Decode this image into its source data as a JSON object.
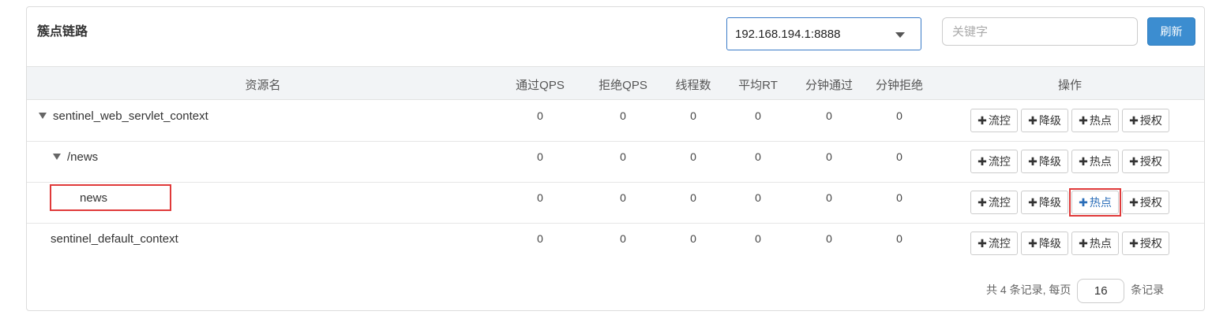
{
  "panel": {
    "title": "簇点链路"
  },
  "toolbar": {
    "machine_select_value": "192.168.194.1:8888",
    "search_placeholder": "关键字",
    "refresh_label": "刷新"
  },
  "table": {
    "columns": [
      "资源名",
      "通过QPS",
      "拒绝QPS",
      "线程数",
      "平均RT",
      "分钟通过",
      "分钟拒绝",
      "操作"
    ],
    "rows": [
      {
        "name": "sentinel_web_servlet_context",
        "pass_qps": "0",
        "block_qps": "0",
        "threads": "0",
        "avg_rt": "0",
        "minute_pass": "0",
        "minute_block": "0"
      },
      {
        "name": "/news",
        "pass_qps": "0",
        "block_qps": "0",
        "threads": "0",
        "avg_rt": "0",
        "minute_pass": "0",
        "minute_block": "0"
      },
      {
        "name": "news",
        "pass_qps": "0",
        "block_qps": "0",
        "threads": "0",
        "avg_rt": "0",
        "minute_pass": "0",
        "minute_block": "0"
      },
      {
        "name": "sentinel_default_context",
        "pass_qps": "0",
        "block_qps": "0",
        "threads": "0",
        "avg_rt": "0",
        "minute_pass": "0",
        "minute_block": "0"
      }
    ],
    "actions": {
      "plus": "✚",
      "flow": "流控",
      "degrade": "降级",
      "hotspot": "热点",
      "authority": "授权"
    }
  },
  "pagination": {
    "prefix": "共 4 条记录, 每页",
    "page_size": "16",
    "suffix": "条记录"
  },
  "colors": {
    "accent": "#3c8dd0",
    "highlight": "#e03a3a"
  },
  "icons": [
    "caret-down-icon",
    "expand-triangle-icon",
    "plus-icon"
  ]
}
